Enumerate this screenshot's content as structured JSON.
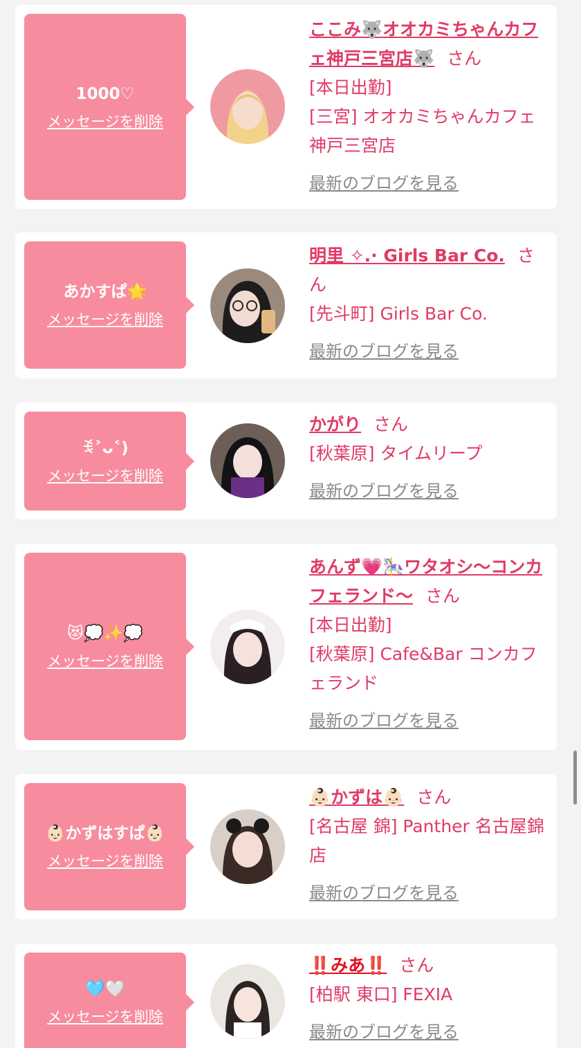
{
  "common": {
    "delete_label": "メッセージを削除",
    "blog_label": "最新のブログを見る",
    "san": "さん"
  },
  "cards": [
    {
      "message": "1000♡",
      "name": "ここみ🐺オオカミちゃんカフェ神戸三宮店🐺",
      "lines": [
        "[本日出勤]",
        "[三宮] オオカミちゃんカフェ神戸三宮店"
      ]
    },
    {
      "message": "あかすぱ🌟",
      "name": "明里 ✧.· Girls Bar Co.",
      "lines": [
        "[先斗町] Girls Bar Co."
      ]
    },
    {
      "message": "ꉂ˃ᴗ˂)",
      "name": "かがり",
      "lines": [
        "[秋葉原] タイムリープ"
      ]
    },
    {
      "message": "😻💭✨💭",
      "name": "あんず💗🎠ワタオシ〜コンカフェランド〜",
      "lines": [
        "[本日出勤]",
        "[秋葉原] Cafe&Bar コンカフェランド"
      ]
    },
    {
      "message": "👶🏻かずはすぱ👶🏻",
      "name": "👶🏻かずは👶🏻",
      "lines": [
        "[名古屋 錦] Panther 名古屋錦店"
      ]
    },
    {
      "message": "🩵🤍",
      "name": "‼️みあ‼️",
      "lines": [
        "[柏駅 東口] FEXIA"
      ]
    }
  ],
  "colors": {
    "accent": "#e03a65",
    "bubble": "#f78c9e",
    "alert_name": "#e0101e",
    "blog_link": "#8a8a8a"
  }
}
